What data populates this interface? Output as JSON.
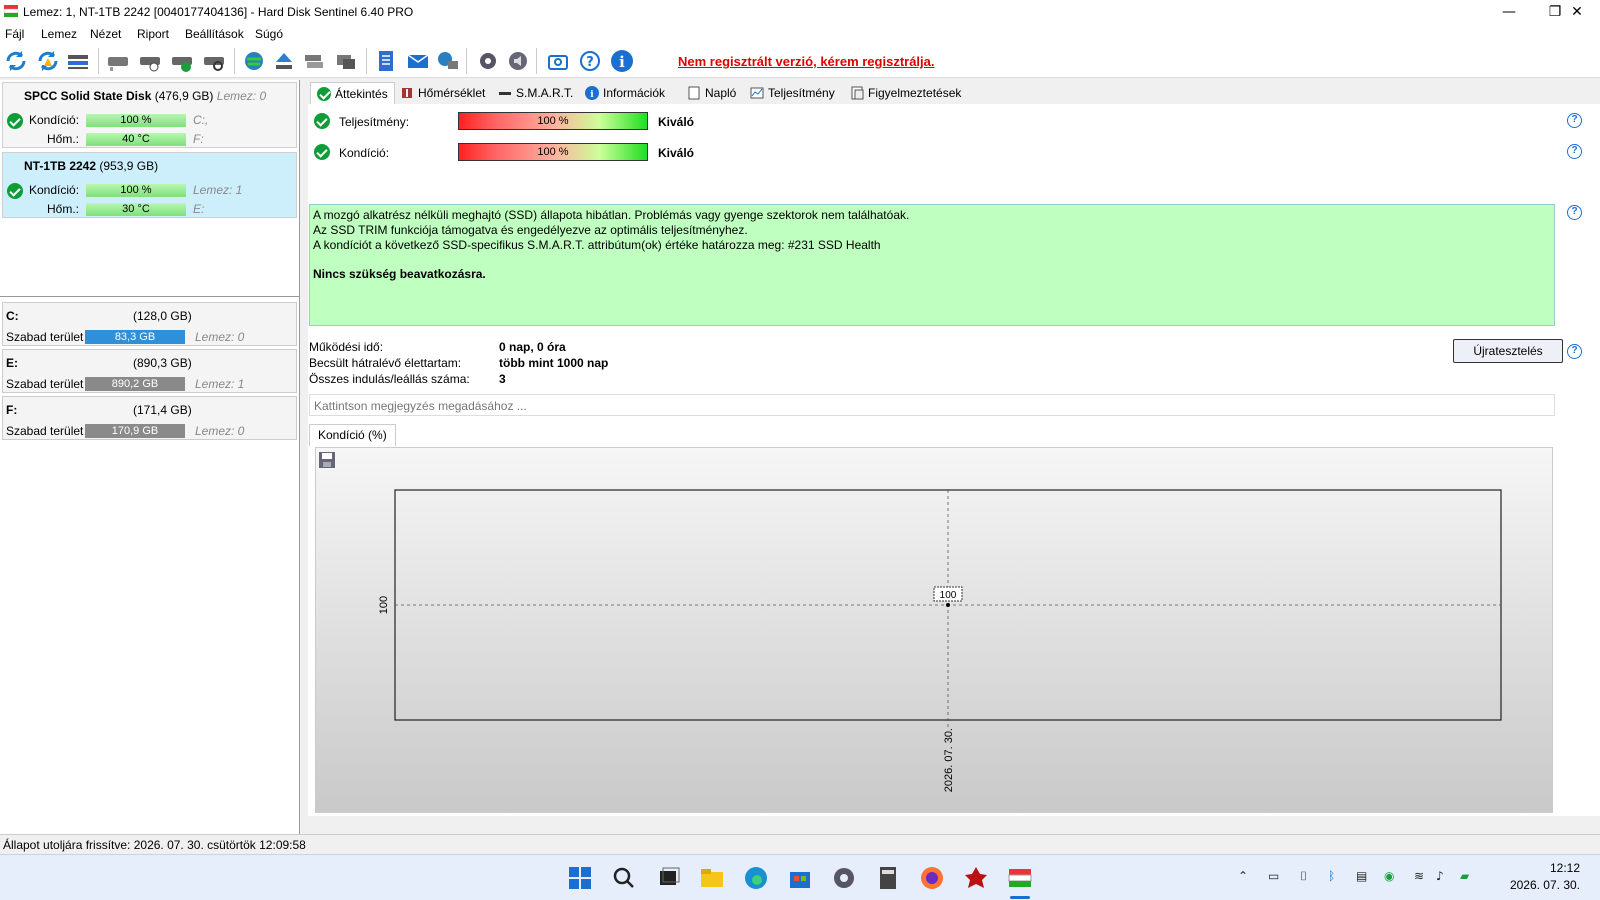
{
  "window": {
    "title": "Lemez: 1, NT-1TB 2242 [0040177404136]  -  Hard Disk Sentinel 6.40 PRO",
    "minimize": "—",
    "maximize": "❐",
    "close": "✕"
  },
  "menu": [
    "Fájl",
    "Lemez",
    "Nézet",
    "Riport",
    "Beállítások",
    "Súgó"
  ],
  "toolbar": {
    "register_notice": "Nem regisztrált verzió, kérem regisztrálja."
  },
  "disks": [
    {
      "name": "SPCC Solid State Disk",
      "size": "(476,9 GB)",
      "lemez": "Lemez: 0",
      "condition_label": "Kondíció:",
      "condition": "100 %",
      "condition_pct": 100,
      "vol_right": "C:,",
      "temp_label": "Hőm.:",
      "temp": "40 °C",
      "vol_right2": "F:",
      "selected": false
    },
    {
      "name": "NT-1TB 2242",
      "size": "(953,9 GB)",
      "lemez": "",
      "condition_label": "Kondíció:",
      "condition": "100 %",
      "condition_pct": 100,
      "vol_right": "Lemez: 1",
      "temp_label": "Hőm.:",
      "temp": "30 °C",
      "vol_right2": "E:",
      "selected": true
    }
  ],
  "volumes": [
    {
      "drive": "C:",
      "size": "(128,0 GB)",
      "free_label": "Szabad terület",
      "free": "83,3 GB",
      "lemez": "Lemez: 0",
      "bar_color": "#2f8fd8"
    },
    {
      "drive": "E:",
      "size": "(890,3 GB)",
      "free_label": "Szabad terület",
      "free": "890,2 GB",
      "lemez": "Lemez: 1",
      "bar_color": "#8a8a8a"
    },
    {
      "drive": "F:",
      "size": "(171,4 GB)",
      "free_label": "Szabad terület",
      "free": "170,9 GB",
      "lemez": "Lemez: 0",
      "bar_color": "#8a8a8a"
    }
  ],
  "tabs": [
    "Áttekintés",
    "Hőmérséklet",
    "S.M.A.R.T.",
    "Információk",
    "Napló",
    "Teljesítmény",
    "Figyelmeztetések"
  ],
  "overview": {
    "performance_label": "Teljesítmény:",
    "performance_value": "100 %",
    "performance_rating": "Kiváló",
    "condition_label": "Kondíció:",
    "condition_value": "100 %",
    "condition_rating": "Kiváló",
    "message_lines": [
      "A mozgó alkatrész nélküli meghajtó (SSD) állapota hibátlan. Problémás vagy gyenge szektorok nem találhatóak.",
      "Az SSD TRIM funkciója támogatva és engedélyezve az optimális teljesítményhez.",
      "A kondíciót a következő SSD-specifikus S.M.A.R.T. attribútum(ok) értéke határozza meg:  #231 SSD Health"
    ],
    "message_bold": "Nincs szükség beavatkozásra.",
    "uptime_label": "Működési idő:",
    "uptime_value": "0 nap, 0 óra",
    "lifetime_label": "Becsült hátralévő élettartam:",
    "lifetime_value": "több mint 1000 nap",
    "starts_label": "Összes indulás/leállás száma:",
    "starts_value": "3",
    "retest_button": "Újratesztelés",
    "note_placeholder": "Kattintson megjegyzés megadásához ...",
    "chart_tab": "Kondíció  (%)"
  },
  "chart_data": {
    "type": "scatter",
    "x": [
      "2026. 07. 30."
    ],
    "values": [
      100
    ],
    "ytick": "100",
    "point_label": "100",
    "grid": true
  },
  "status": {
    "text": "Állapot utoljára frissítve: 2026. 07. 30. csütörtök 12:09:58"
  },
  "taskbar": {
    "time": "12:12",
    "date": "2026. 07. 30."
  }
}
